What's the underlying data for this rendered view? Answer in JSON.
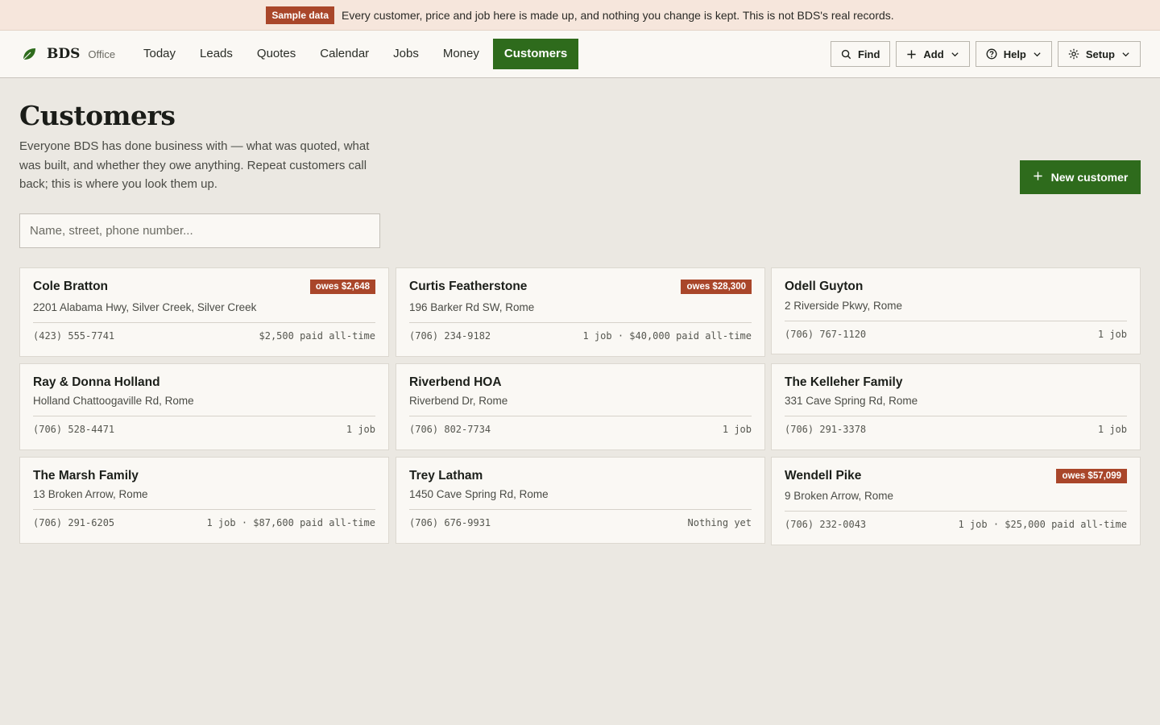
{
  "banner": {
    "tag": "Sample data",
    "message": "Every customer, price and job here is made up, and nothing you change is kept. This is not BDS's real records."
  },
  "brand": {
    "name": "BDS",
    "subtitle": "Office",
    "icon": "leaf-icon"
  },
  "nav": {
    "items": [
      {
        "label": "Today"
      },
      {
        "label": "Leads"
      },
      {
        "label": "Quotes"
      },
      {
        "label": "Calendar"
      },
      {
        "label": "Jobs"
      },
      {
        "label": "Money"
      },
      {
        "label": "Customers",
        "active": true
      }
    ]
  },
  "actions": {
    "find": {
      "label": "Find",
      "icon": "search-icon"
    },
    "add": {
      "label": "Add",
      "icon": "plus-icon"
    },
    "help": {
      "label": "Help",
      "icon": "help-circle-icon"
    },
    "setup": {
      "label": "Setup",
      "icon": "gear-icon"
    }
  },
  "page": {
    "title": "Customers",
    "intro": "Everyone BDS has done business with — what was quoted, what was built, and whether they owe anything. Repeat customers call back; this is where you look them up.",
    "new_button": "New customer",
    "search_placeholder": "Name, street, phone number..."
  },
  "customers": [
    {
      "name": "Cole Bratton",
      "owes": "owes $2,648",
      "address": "2201 Alabama Hwy, Silver Creek, Silver Creek",
      "phone": "(423) 555-7741",
      "summary": "$2,500 paid all-time"
    },
    {
      "name": "Curtis Featherstone",
      "owes": "owes $28,300",
      "address": "196 Barker Rd SW, Rome",
      "phone": "(706) 234-9182",
      "summary": "1 job · $40,000 paid all-time"
    },
    {
      "name": "Odell Guyton",
      "owes": "",
      "address": "2 Riverside Pkwy, Rome",
      "phone": "(706) 767-1120",
      "summary": "1 job"
    },
    {
      "name": "Ray & Donna Holland",
      "owes": "",
      "address": "Holland Chattoogaville Rd, Rome",
      "phone": "(706) 528-4471",
      "summary": "1 job"
    },
    {
      "name": "Riverbend HOA",
      "owes": "",
      "address": "Riverbend Dr, Rome",
      "phone": "(706) 802-7734",
      "summary": "1 job"
    },
    {
      "name": "The Kelleher Family",
      "owes": "",
      "address": "331 Cave Spring Rd, Rome",
      "phone": "(706) 291-3378",
      "summary": "1 job"
    },
    {
      "name": "The Marsh Family",
      "owes": "",
      "address": "13 Broken Arrow, Rome",
      "phone": "(706) 291-6205",
      "summary": "1 job · $87,600 paid all-time"
    },
    {
      "name": "Trey Latham",
      "owes": "",
      "address": "1450 Cave Spring Rd, Rome",
      "phone": "(706) 676-9931",
      "summary": "Nothing yet"
    },
    {
      "name": "Wendell Pike",
      "owes": "owes $57,099",
      "address": "9 Broken Arrow, Rome",
      "phone": "(706) 232-0043",
      "summary": "1 job · $25,000 paid all-time"
    }
  ],
  "colors": {
    "accent": "#2e6b1c",
    "owes": "#a9462a",
    "banner_bg": "#f6e6dc",
    "page_bg": "#ebe8e2"
  }
}
